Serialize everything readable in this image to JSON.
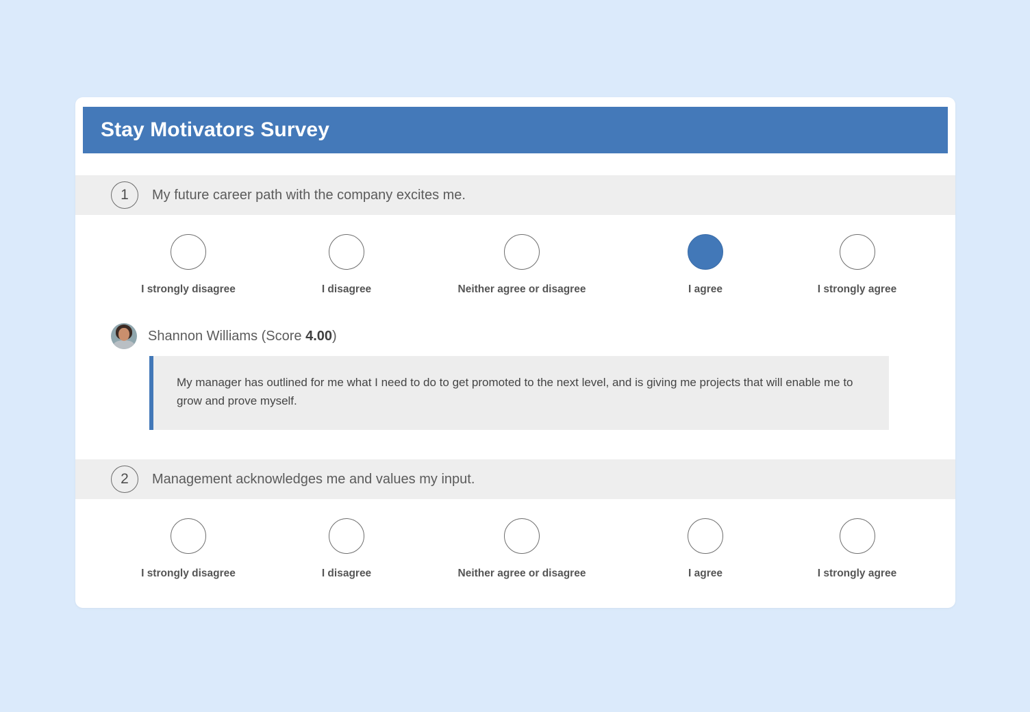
{
  "theme": {
    "page_background": "#dbeafb",
    "header_blue": "#4479b9",
    "accent_blue": "#4278b8",
    "band_gray": "#eeeeee",
    "comment_gray": "#ededed"
  },
  "header": {
    "title": "Stay Motivators Survey"
  },
  "scale_options": [
    "I strongly disagree",
    "I disagree",
    "Neither agree or disagree",
    "I agree",
    "I strongly agree"
  ],
  "questions": [
    {
      "number": "1",
      "text": "My future career path with the company excites me.",
      "selected_index": 3,
      "comment": {
        "avatar_name": "avatar-shannon-williams",
        "author_prefix": "Shannon Williams (Score ",
        "score": "4.00",
        "author_suffix": ")",
        "body": "My manager has outlined for me what I need to do to get promoted to the next level, and is giving me projects that will enable me to grow and prove myself."
      }
    },
    {
      "number": "2",
      "text": "Management acknowledges me and values my input.",
      "selected_index": -1,
      "comment": null
    }
  ]
}
